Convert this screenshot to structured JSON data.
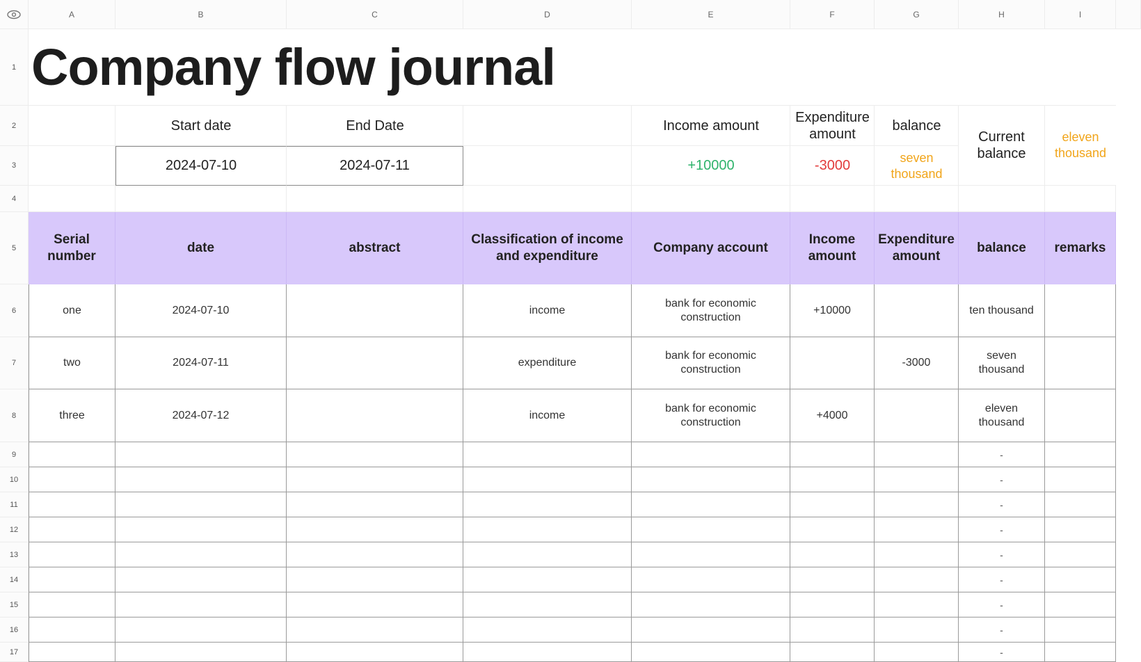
{
  "columns": [
    "A",
    "B",
    "C",
    "D",
    "E",
    "F",
    "G",
    "H",
    "I"
  ],
  "row_numbers": [
    "1",
    "2",
    "3",
    "4",
    "5",
    "6",
    "7",
    "8",
    "9",
    "10",
    "11",
    "12",
    "13",
    "14",
    "15",
    "16",
    "17"
  ],
  "title": "Company flow journal",
  "summary": {
    "start_date_label": "Start date",
    "end_date_label": "End Date",
    "income_label": "Income amount",
    "expenditure_label": "Expenditure amount",
    "balance_label": "balance",
    "current_balance_label": "Current balance",
    "start_date": "2024-07-10",
    "end_date": "2024-07-11",
    "income": "+10000",
    "expenditure": "-3000",
    "balance": "seven thousand",
    "current_balance": "eleven thousand"
  },
  "table": {
    "headers": [
      "Serial number",
      "date",
      "abstract",
      "Classification of income and expenditure",
      "Company account",
      "Income amount",
      "Expenditure amount",
      "balance",
      "remarks"
    ],
    "rows": [
      {
        "serial": "one",
        "date": "2024-07-10",
        "abstract": "",
        "classification": "income",
        "account": "bank for economic construction",
        "income": "+10000",
        "expenditure": "",
        "balance": "ten thousand",
        "remarks": ""
      },
      {
        "serial": "two",
        "date": "2024-07-11",
        "abstract": "",
        "classification": "expenditure",
        "account": "bank for economic construction",
        "income": "",
        "expenditure": "-3000",
        "balance": "seven thousand",
        "remarks": ""
      },
      {
        "serial": "three",
        "date": "2024-07-12",
        "abstract": "",
        "classification": "income",
        "account": "bank for economic construction",
        "income": "+4000",
        "expenditure": "",
        "balance": "eleven thousand",
        "remarks": ""
      }
    ],
    "empty_balance_marker": "-"
  },
  "colors": {
    "header_fill": "#d8c8fb",
    "income_green": "#2fb36b",
    "expense_red": "#e23b3b",
    "balance_orange": "#f1a51a"
  },
  "icons": {
    "corner": "eye-icon"
  }
}
